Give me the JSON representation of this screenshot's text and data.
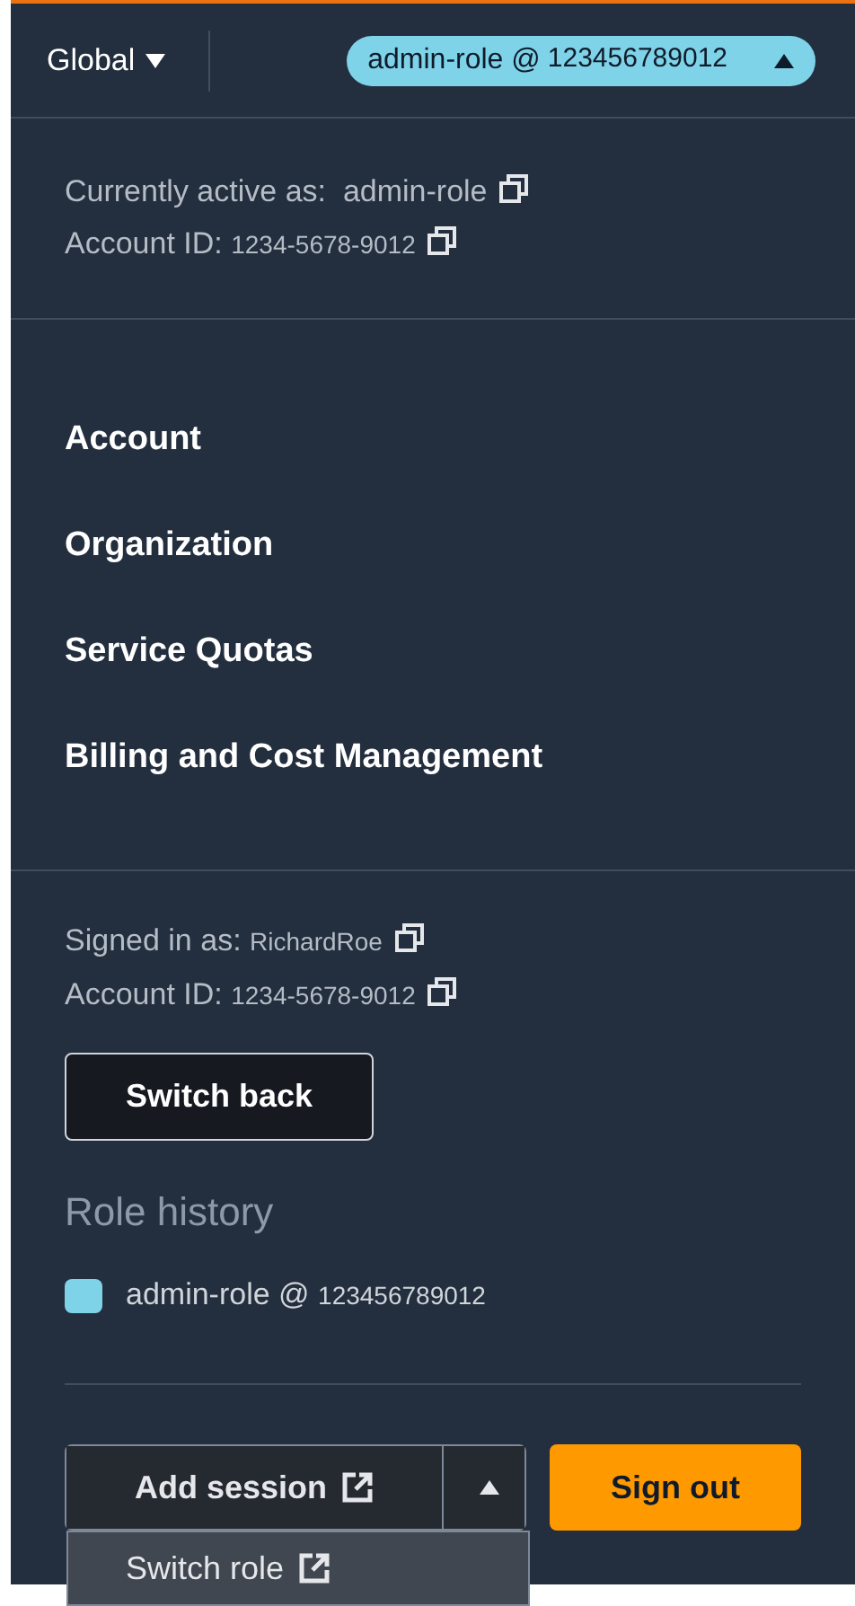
{
  "header": {
    "region": "Global",
    "session": {
      "role": "admin-role @",
      "account": "123456789012",
      "expanded": true
    }
  },
  "active": {
    "label": "Currently active as:",
    "role": "admin-role",
    "account_label": "Account ID:",
    "account": "1234-5678-9012"
  },
  "menu": [
    "Account",
    "Organization",
    "Service Quotas",
    "Billing and Cost Management"
  ],
  "signed_in": {
    "label": "Signed in as:",
    "user": "RichardRoe",
    "account_label": "Account ID:",
    "account": "1234-5678-9012"
  },
  "switch_back": "Switch back",
  "role_history": {
    "title": "Role history",
    "items": [
      {
        "role": "admin-role @",
        "account": "123456789012",
        "color": "#7fd3e8"
      }
    ]
  },
  "add_session": "Add session",
  "sign_out": "Sign out",
  "dropdown": [
    "Switch role"
  ]
}
